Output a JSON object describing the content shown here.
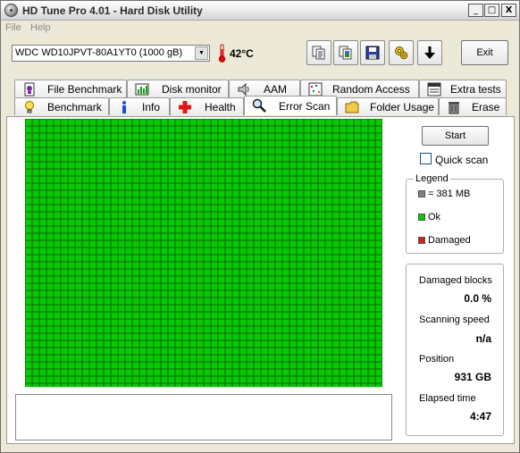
{
  "window": {
    "title": "HD Tune Pro 4.01 - Hard Disk Utility",
    "buttons": {
      "minimize": "_",
      "maximize": "□",
      "close": "X"
    }
  },
  "menu": {
    "file": "File",
    "help": "Help"
  },
  "toolbar": {
    "drive": "WDC WD10JPVT-80A1YT0 (1000 gB)",
    "temperature": "42°C",
    "exit_label": "Exit",
    "icons": [
      "copy-text-icon",
      "copy-image-icon",
      "save-icon",
      "options-icon",
      "download-arrow-icon"
    ]
  },
  "tabs": {
    "top": [
      {
        "label": "File Benchmark",
        "icon": "file-benchmark-icon"
      },
      {
        "label": "Disk monitor",
        "icon": "disk-monitor-icon"
      },
      {
        "label": "AAM",
        "icon": "speaker-icon"
      },
      {
        "label": "Random Access",
        "icon": "random-access-icon"
      },
      {
        "label": "Extra tests",
        "icon": "extra-tests-icon"
      }
    ],
    "bottom": [
      {
        "label": "Benchmark",
        "icon": "lightbulb-icon"
      },
      {
        "label": "Info",
        "icon": "info-icon"
      },
      {
        "label": "Health",
        "icon": "health-cross-icon"
      },
      {
        "label": "Error Scan",
        "icon": "magnifier-icon",
        "active": true
      },
      {
        "label": "Folder Usage",
        "icon": "folder-icon"
      },
      {
        "label": "Erase",
        "icon": "trash-icon"
      }
    ]
  },
  "scan": {
    "start_label": "Start",
    "quick_scan_label": "Quick scan",
    "quick_scan_checked": false,
    "block_status": "ok",
    "colors": {
      "ok": "#00cc00",
      "damaged": "#cc2222",
      "block": "#808080",
      "gridline": "#1f5e12"
    }
  },
  "legend": {
    "title": "Legend",
    "items": [
      {
        "label": "= 381 MB",
        "color": "#808080"
      },
      {
        "label": "Ok",
        "color": "#00cc00"
      },
      {
        "label": "Damaged",
        "color": "#cc2222"
      }
    ]
  },
  "stats": {
    "damaged_blocks_label": "Damaged blocks",
    "damaged_blocks_value": "0.0 %",
    "scanning_speed_label": "Scanning speed",
    "scanning_speed_value": "n/a",
    "position_label": "Position",
    "position_value": "931 GB",
    "elapsed_time_label": "Elapsed time",
    "elapsed_time_value": "4:47"
  }
}
